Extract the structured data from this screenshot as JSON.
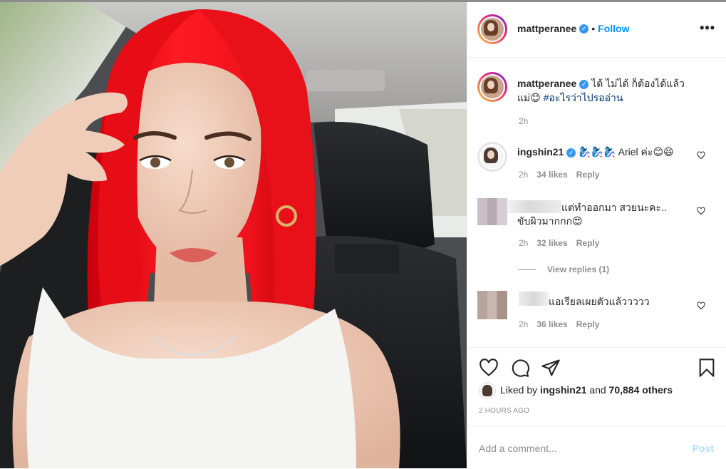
{
  "post": {
    "username": "mattperanee",
    "follow_label": "Follow",
    "more_label": "•••",
    "dot": "•",
    "caption_line1": "ได้ ไม่ได้ ก็ต้องได้แล้ว",
    "caption_line2_start": "แม่😊 ",
    "caption_hashtag": "#อะไรว่าไปรออ่าน",
    "caption_time": "2h",
    "likes_prefix": "Liked by ",
    "likes_user": "ingshin21",
    "likes_and": " and ",
    "likes_others": "70,884 others",
    "time_ago": "2 HOURS AGO",
    "comment_placeholder": "Add a comment...",
    "post_button": "Post"
  },
  "comments": [
    {
      "username": "ingshin21",
      "text": "🧞‍♀️🧞‍♀️🧞‍♀️ Ariel ค่ะ😊😆",
      "time": "2h",
      "likes": "34 likes",
      "reply": "Reply"
    },
    {
      "username": "",
      "text_line1": "แต่ทำออกมา สวยนะคะ..",
      "text_line2": "ขับผิวมากกก😍",
      "time": "2h",
      "likes": "32 likes",
      "reply": "Reply"
    },
    {
      "username": "",
      "text": "แอเรียลเผยตัวแล้ววววว",
      "time": "2h",
      "likes": "36 likes",
      "reply": "Reply"
    }
  ],
  "view_replies": "View replies (1)",
  "icons": [
    "heart-icon",
    "comment-icon",
    "share-icon",
    "bookmark-icon",
    "verified-icon",
    "more-icon"
  ],
  "colors": {
    "link": "#0095f6",
    "hashtag": "#00376b",
    "hair": "#e8141c",
    "verified": "#3897f0"
  }
}
